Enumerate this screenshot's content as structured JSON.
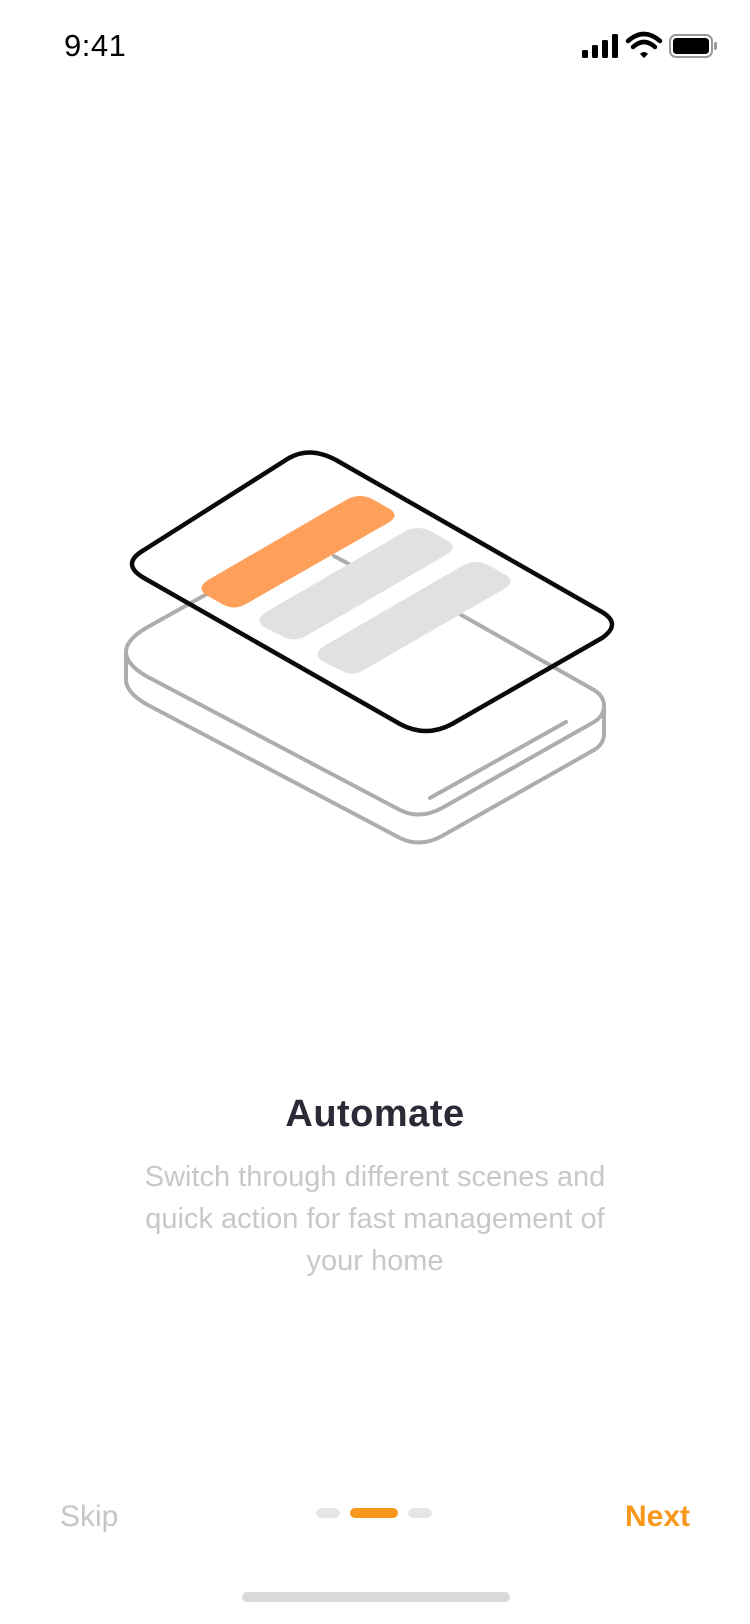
{
  "status_bar": {
    "time": "9:41",
    "icons": [
      "signal-icon",
      "wifi-icon",
      "battery-icon"
    ]
  },
  "onboarding": {
    "title": "Automate",
    "description": "Switch through different scenes and quick action for fast management of your home"
  },
  "navigation": {
    "skip_label": "Skip",
    "next_label": "Next",
    "page_count": 3,
    "current_page": 2
  },
  "colors": {
    "accent": "#f7971c",
    "illustration_highlight": "#ffa05a",
    "title": "#2b2a37",
    "muted_text": "#c8c8cc"
  }
}
